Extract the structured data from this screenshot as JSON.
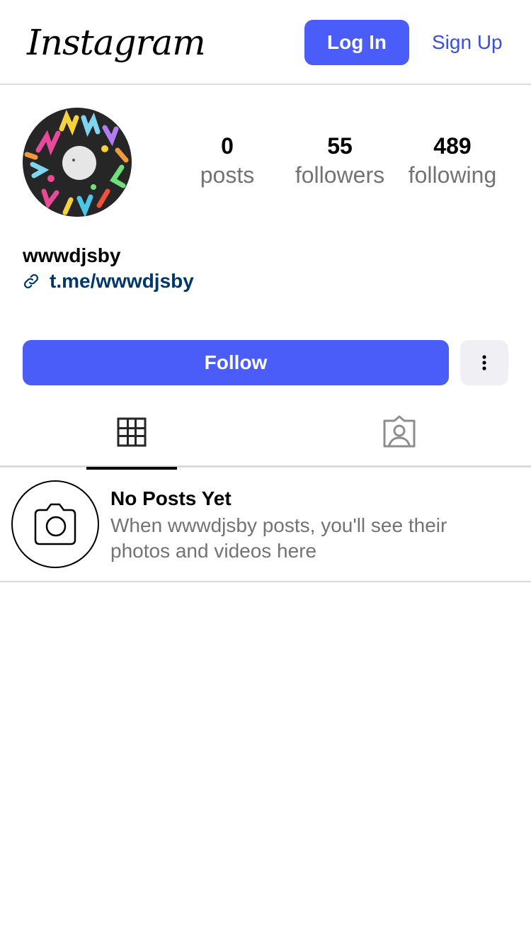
{
  "header": {
    "logo_text": "Instagram",
    "login_label": "Log In",
    "signup_label": "Sign Up"
  },
  "profile": {
    "username": "wwwdjsby",
    "link": "t.me/wwwdjsby",
    "stats": [
      {
        "value": "0",
        "label": "posts"
      },
      {
        "value": "55",
        "label": "followers"
      },
      {
        "value": "489",
        "label": "following"
      }
    ]
  },
  "actions": {
    "follow_label": "Follow",
    "more_icon": "more-vertical-icon"
  },
  "tabs": [
    {
      "icon": "grid-icon",
      "active": true
    },
    {
      "icon": "tagged-user-icon",
      "active": false
    }
  ],
  "empty_state": {
    "icon": "camera-icon",
    "title": "No Posts Yet",
    "description": "When wwwdjsby posts, you'll see their photos and videos here"
  },
  "colors": {
    "accent": "#4a5df9",
    "link": "#00376b",
    "secondary_text": "#737373",
    "divider": "#dbdbdb"
  }
}
